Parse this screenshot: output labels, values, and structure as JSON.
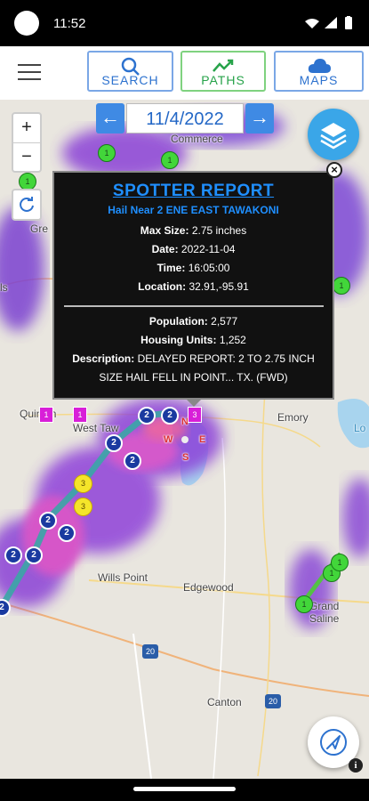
{
  "status": {
    "time": "11:52"
  },
  "toolbar": {
    "search_label": "SEARCH",
    "paths_label": "PATHS",
    "maps_label": "MAPS"
  },
  "date_nav": {
    "date": "11/4/2022",
    "prev": "←",
    "next": "→"
  },
  "zoom": {
    "in": "+",
    "out": "−"
  },
  "map": {
    "places": {
      "commerce": "Commerce",
      "quinlan": "Quinlan",
      "west_tawakoni": "West Taw",
      "emory": "Emory",
      "wills_point": "Wills Point",
      "edgewood": "Edgewood",
      "grand_saline": "Grand Saline",
      "canton": "Canton",
      "greenville": "Gre",
      "left_edge": "ls",
      "lake": "Lo"
    },
    "highways": {
      "i20": "20",
      "i20b": "20"
    },
    "compass": {
      "n": "N",
      "w": "W",
      "e": "E",
      "s": "S"
    }
  },
  "popup": {
    "title": "SPOTTER REPORT",
    "subtitle": "Hail Near 2 ENE EAST TAWAKONI",
    "max_size_label": "Max Size:",
    "max_size": "2.75 inches",
    "date_label": "Date:",
    "date": "2022-11-04",
    "time_label": "Time:",
    "time": "16:05:00",
    "location_label": "Location:",
    "location": "32.91,-95.91",
    "population_label": "Population:",
    "population": "2,577",
    "housing_label": "Housing Units:",
    "housing": "1,252",
    "description_label": "Description:",
    "description": "DELAYED REPORT: 2 TO 2.75 INCH SIZE HAIL FELL IN POINT... TX. (FWD)",
    "close": "×"
  },
  "info": "i",
  "markers": {
    "green": "1",
    "yellow": "3",
    "blue": "2",
    "magenta": "1",
    "magenta3": "3"
  },
  "colors": {
    "accent_blue": "#2d72cf",
    "paths_green": "#27a34a",
    "popup_title": "#1f8fff",
    "layers_button": "#3aa6e8"
  }
}
